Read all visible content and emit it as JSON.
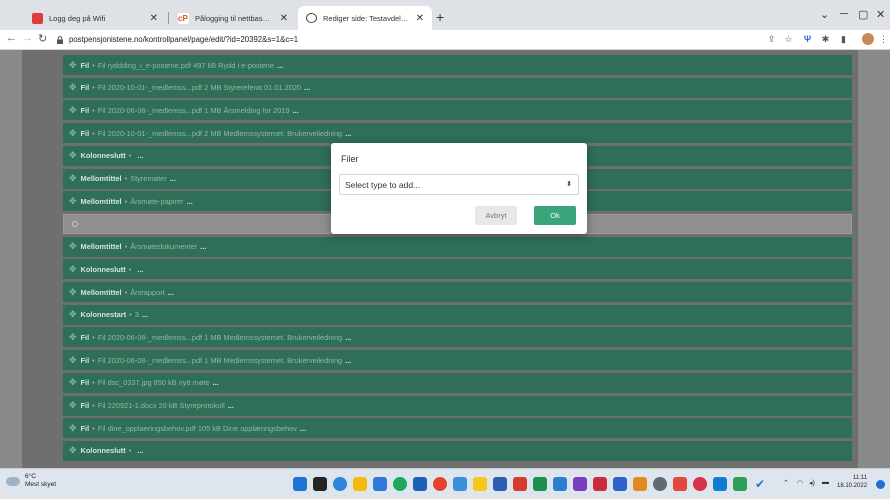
{
  "browser": {
    "tabs": [
      {
        "title": "Logg deg på Wifi",
        "favicon": "wifi-portal-icon",
        "color": "#e23b3b",
        "active": false
      },
      {
        "title": "Pålogging til nettbasert e-post",
        "favicon": "webmail-icon",
        "color": "#d9532b",
        "active": false
      },
      {
        "title": "Rediger side: Testavdeling • posti",
        "favicon": "globe-icon",
        "color": "#333333",
        "active": true
      }
    ],
    "new_tab": "+",
    "url": "postpensjonistene.no/kontrollpanel/page/edit/?id=20392&s=1&c=1"
  },
  "page": {
    "rows": [
      {
        "kind": "Fil",
        "detail": "Fil ryddding_i_e-postene.pdf 497 kB Rydd i e-postene",
        "ellipsis": "..."
      },
      {
        "kind": "Fil",
        "detail": "Fil 2020-10-01-_medlemss...pdf 2 MB Styrereferat 01.01.2020",
        "ellipsis": "..."
      },
      {
        "kind": "Fil",
        "detail": "Fil 2020-06-08-_medlemss...pdf 1 MB Årsmelding for 2019",
        "ellipsis": "..."
      },
      {
        "kind": "Fil",
        "detail": "Fil 2020-10-01-_medlemss...pdf 2 MB Medlemssystemet. Brukerveiledning",
        "ellipsis": "..."
      },
      {
        "kind": "Kolonneslutt",
        "detail": "",
        "ellipsis": "..."
      },
      {
        "kind": "Mellomtittel",
        "detail": "Styremøter",
        "ellipsis": "..."
      },
      {
        "kind": "Mellomtittel",
        "detail": "Årsmøte-papirer",
        "ellipsis": "..."
      },
      {
        "kind": "",
        "detail": "",
        "ellipsis": "",
        "placeholder": true
      },
      {
        "kind": "Mellomtittel",
        "detail": "Årsmøtedokumenter",
        "ellipsis": "..."
      },
      {
        "kind": "Kolonneslutt",
        "detail": "",
        "ellipsis": "..."
      },
      {
        "kind": "Mellomtittel",
        "detail": "Årsrapport",
        "ellipsis": "..."
      },
      {
        "kind": "Kolonnestart",
        "detail": "3",
        "ellipsis": "..."
      },
      {
        "kind": "Fil",
        "detail": "Fil 2020-06-08-_medlemss...pdf 1 MB Medlemssystemet. Brukerveiledning",
        "ellipsis": "..."
      },
      {
        "kind": "Fil",
        "detail": "Fil 2020-06-08-_medlemss...pdf 1 MB Medlemssystemet. Brukerveiledning",
        "ellipsis": "..."
      },
      {
        "kind": "Fil",
        "detail": "Fil dsc_0337.jpg 850 kB nytt møte",
        "ellipsis": "..."
      },
      {
        "kind": "Fil",
        "detail": "Fil 220921-1.docx 20 kB Styreprotokoll",
        "ellipsis": "..."
      },
      {
        "kind": "Fil",
        "detail": "Fil dine_opplaeringsbehov.pdf 105 kB Dine opplæringsbehov",
        "ellipsis": "..."
      },
      {
        "kind": "Kolonneslutt",
        "detail": "",
        "ellipsis": "..."
      }
    ]
  },
  "modal": {
    "title": "Filer",
    "select_value": "Select type to add...",
    "cancel_label": "Avbryt",
    "ok_label": "Ok",
    "accent": "#3aa57b"
  },
  "taskbar": {
    "weather_temp": "6°C",
    "weather_text": "Mest skyet",
    "time": "11:11",
    "date": "18.10.2022",
    "row_color": "#2f6f57"
  }
}
